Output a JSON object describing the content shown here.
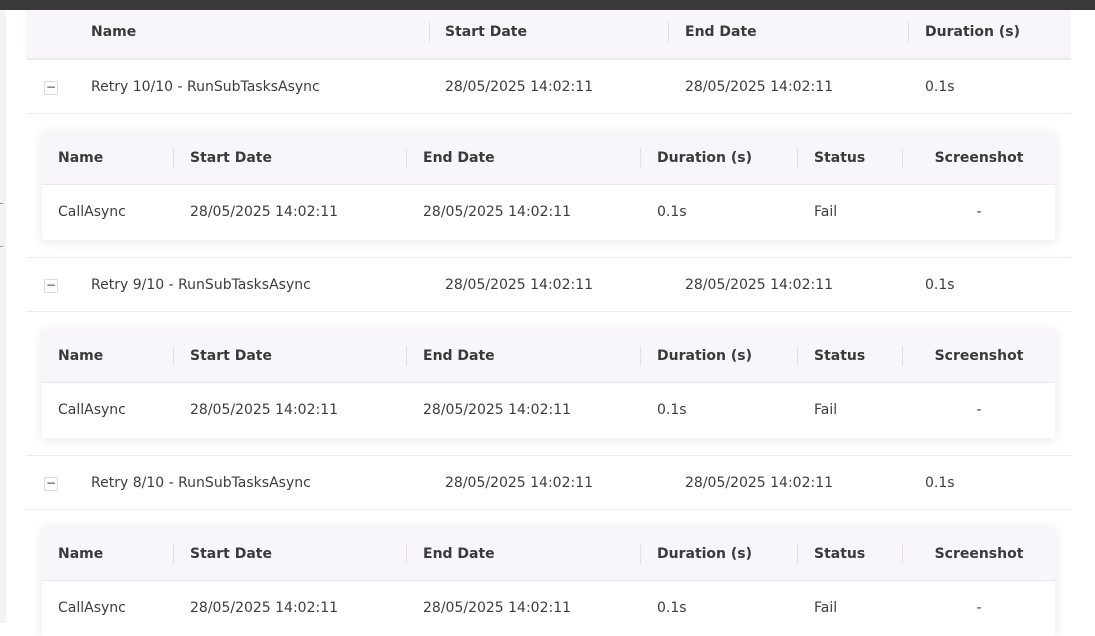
{
  "table": {
    "headers": {
      "name": "Name",
      "start": "Start Date",
      "end": "End Date",
      "duration": "Duration (s)"
    }
  },
  "subtable": {
    "headers": {
      "name": "Name",
      "start": "Start Date",
      "end": "End Date",
      "duration": "Duration (s)",
      "status": "Status",
      "screenshot": "Screenshot"
    }
  },
  "toggle_symbol": "−",
  "retries": [
    {
      "name": "Retry 10/10 - RunSubTasksAsync",
      "start": "28/05/2025 14:02:11",
      "end": "28/05/2025 14:02:11",
      "duration": "0.1s",
      "subtasks": [
        {
          "name": "CallAsync",
          "start": "28/05/2025 14:02:11",
          "end": "28/05/2025 14:02:11",
          "duration": "0.1s",
          "status": "Fail",
          "screenshot": "-"
        }
      ]
    },
    {
      "name": "Retry 9/10 - RunSubTasksAsync",
      "start": "28/05/2025 14:02:11",
      "end": "28/05/2025 14:02:11",
      "duration": "0.1s",
      "subtasks": [
        {
          "name": "CallAsync",
          "start": "28/05/2025 14:02:11",
          "end": "28/05/2025 14:02:11",
          "duration": "0.1s",
          "status": "Fail",
          "screenshot": "-"
        }
      ]
    },
    {
      "name": "Retry 8/10 - RunSubTasksAsync",
      "start": "28/05/2025 14:02:11",
      "end": "28/05/2025 14:02:11",
      "duration": "0.1s",
      "subtasks": [
        {
          "name": "CallAsync",
          "start": "28/05/2025 14:02:11",
          "end": "28/05/2025 14:02:11",
          "duration": "0.1s",
          "status": "Fail",
          "screenshot": "-"
        }
      ]
    }
  ]
}
